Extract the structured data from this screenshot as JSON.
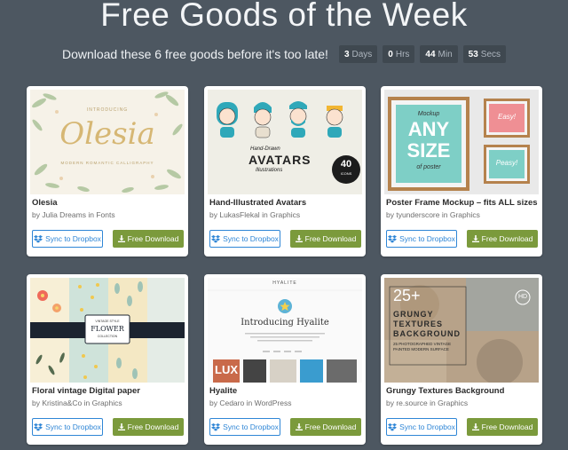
{
  "header": {
    "title": "Free Goods of the Week",
    "subtitle": "Download these 6 free goods before it's too late!",
    "countdown": [
      {
        "value": "3",
        "unit": "Days"
      },
      {
        "value": "0",
        "unit": "Hrs"
      },
      {
        "value": "44",
        "unit": "Min"
      },
      {
        "value": "53",
        "unit": "Secs"
      }
    ]
  },
  "buttons": {
    "dropbox": "Sync to Dropbox",
    "download": "Free Download"
  },
  "cards": [
    {
      "title": "Olesia",
      "author": "Julia Dreams",
      "in_word": "in",
      "category": "Fonts",
      "thumb": {
        "line1": "INTRODUCING",
        "word": "Olesia",
        "line2": "MODERN ROMANTIC CALLIGRAPHY"
      }
    },
    {
      "title": "Hand-Illustrated Avatars",
      "author": "LukasFlekal",
      "in_word": "in",
      "category": "Graphics",
      "thumb": {
        "line1": "Hand-Drawn",
        "word": "AVATARS",
        "line2": "Illustrations",
        "badge_num": "40",
        "badge_text": "ICONS"
      }
    },
    {
      "title": "Poster Frame Mockup – fits ALL sizes",
      "author": "tyunderscore",
      "in_word": "in",
      "category": "Graphics",
      "thumb": {
        "line1": "Mockup",
        "word_a": "ANY",
        "word_b": "SIZE",
        "line2": "of poster",
        "small1": "Easy!",
        "small2": "Peasy!"
      }
    },
    {
      "title": "Floral vintage Digital paper",
      "author": "Kristina&Co",
      "in_word": "in",
      "category": "Graphics",
      "thumb": {
        "line1": "VINTAGE STYLE",
        "word": "FLOWER",
        "line2": "COLLECTION"
      }
    },
    {
      "title": "Hyalite",
      "author": "Cedaro",
      "in_word": "in",
      "category": "WordPress",
      "thumb": {
        "line1": "HYALITE",
        "word": "Introducing Hyalite",
        "tile": "LUX"
      }
    },
    {
      "title": "Grungy Textures Background",
      "author": "re.source",
      "in_word": "in",
      "category": "Graphics",
      "thumb": {
        "line1": "25+",
        "word_a": "GRUNGY",
        "word_b": "TEXTURES",
        "word_c": "BACKGROUND",
        "line2": "25 PHOTOGRAPHED VINTAGE PAINTED MODERN SURFACE",
        "badge": "HD"
      }
    }
  ],
  "colors": {
    "background": "#4d5761",
    "dropbox_blue": "#2f86d6",
    "download_green": "#7b9a3c"
  },
  "icons": {
    "dropbox": "dropbox-icon",
    "download": "download-icon"
  }
}
